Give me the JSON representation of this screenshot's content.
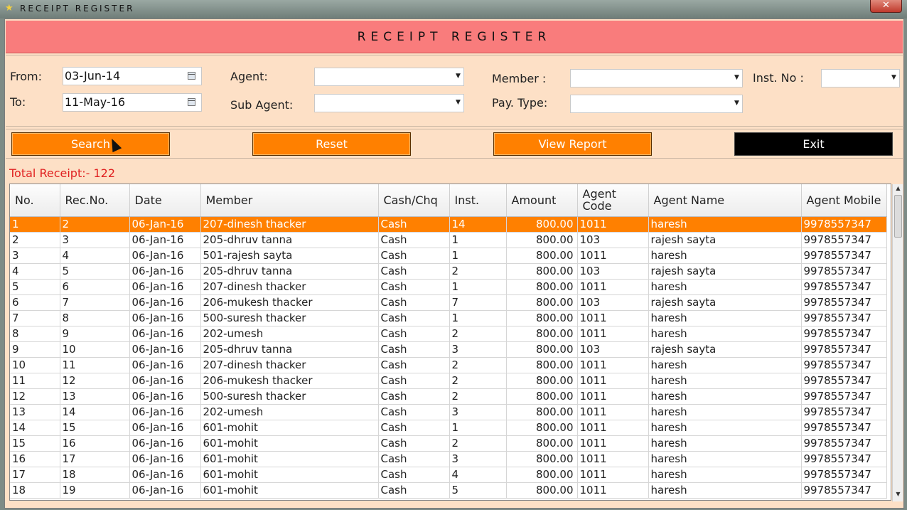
{
  "window": {
    "title": "RECEIPT REGISTER",
    "close_label": "✕"
  },
  "header": {
    "title": "RECEIPT REGISTER"
  },
  "filters": {
    "from_label": "From:",
    "from_value": "03-Jun-14",
    "to_label": "To:",
    "to_value": "11-May-16",
    "agent_label": "Agent:",
    "agent_value": "",
    "sub_agent_label": "Sub Agent:",
    "sub_agent_value": "",
    "member_label": "Member :",
    "member_value": "",
    "pay_type_label": "Pay. Type:",
    "pay_type_value": "",
    "inst_no_label": "Inst. No :",
    "inst_no_value": ""
  },
  "buttons": {
    "search": "Search",
    "reset": "Reset",
    "view_report": "View Report",
    "exit": "Exit"
  },
  "total_receipt": "Total Receipt:- 122",
  "table": {
    "headers": [
      "No.",
      "Rec.No.",
      "Date",
      "Member",
      "Cash/Chq",
      "Inst.",
      "Amount",
      "Agent Code",
      "Agent Name",
      "Agent Mobile"
    ],
    "selected_row": 0,
    "rows": [
      [
        "1",
        "2",
        "06-Jan-16",
        "207-dinesh thacker",
        "Cash",
        "14",
        "800.00",
        "1011",
        "haresh",
        "9978557347"
      ],
      [
        "2",
        "3",
        "06-Jan-16",
        "205-dhruv tanna",
        "Cash",
        "1",
        "800.00",
        "103",
        "rajesh sayta",
        "9978557347"
      ],
      [
        "3",
        "4",
        "06-Jan-16",
        "501-rajesh sayta",
        "Cash",
        "1",
        "800.00",
        "1011",
        "haresh",
        "9978557347"
      ],
      [
        "4",
        "5",
        "06-Jan-16",
        "205-dhruv tanna",
        "Cash",
        "2",
        "800.00",
        "103",
        "rajesh sayta",
        "9978557347"
      ],
      [
        "5",
        "6",
        "06-Jan-16",
        "207-dinesh thacker",
        "Cash",
        "1",
        "800.00",
        "1011",
        "haresh",
        "9978557347"
      ],
      [
        "6",
        "7",
        "06-Jan-16",
        "206-mukesh thacker",
        "Cash",
        "7",
        "800.00",
        "103",
        "rajesh sayta",
        "9978557347"
      ],
      [
        "7",
        "8",
        "06-Jan-16",
        "500-suresh thacker",
        "Cash",
        "1",
        "800.00",
        "1011",
        "haresh",
        "9978557347"
      ],
      [
        "8",
        "9",
        "06-Jan-16",
        "202-umesh",
        "Cash",
        "2",
        "800.00",
        "1011",
        "haresh",
        "9978557347"
      ],
      [
        "9",
        "10",
        "06-Jan-16",
        "205-dhruv tanna",
        "Cash",
        "3",
        "800.00",
        "103",
        "rajesh sayta",
        "9978557347"
      ],
      [
        "10",
        "11",
        "06-Jan-16",
        "207-dinesh thacker",
        "Cash",
        "2",
        "800.00",
        "1011",
        "haresh",
        "9978557347"
      ],
      [
        "11",
        "12",
        "06-Jan-16",
        "206-mukesh thacker",
        "Cash",
        "2",
        "800.00",
        "1011",
        "haresh",
        "9978557347"
      ],
      [
        "12",
        "13",
        "06-Jan-16",
        "500-suresh thacker",
        "Cash",
        "2",
        "800.00",
        "1011",
        "haresh",
        "9978557347"
      ],
      [
        "13",
        "14",
        "06-Jan-16",
        "202-umesh",
        "Cash",
        "3",
        "800.00",
        "1011",
        "haresh",
        "9978557347"
      ],
      [
        "14",
        "15",
        "06-Jan-16",
        "601-mohit",
        "Cash",
        "1",
        "800.00",
        "1011",
        "haresh",
        "9978557347"
      ],
      [
        "15",
        "16",
        "06-Jan-16",
        "601-mohit",
        "Cash",
        "2",
        "800.00",
        "1011",
        "haresh",
        "9978557347"
      ],
      [
        "16",
        "17",
        "06-Jan-16",
        "601-mohit",
        "Cash",
        "3",
        "800.00",
        "1011",
        "haresh",
        "9978557347"
      ],
      [
        "17",
        "18",
        "06-Jan-16",
        "601-mohit",
        "Cash",
        "4",
        "800.00",
        "1011",
        "haresh",
        "9978557347"
      ],
      [
        "18",
        "19",
        "06-Jan-16",
        "601-mohit",
        "Cash",
        "5",
        "800.00",
        "1011",
        "haresh",
        "9978557347"
      ]
    ]
  },
  "icons": {
    "app": "star-icon",
    "calendar": "calendar-icon",
    "dropdown": "chevron-down-icon",
    "cursor": "mouse-pointer-icon"
  },
  "colors": {
    "header_bg": "#f97c7c",
    "panel_bg": "#fde0c6",
    "button": "#ff8000",
    "exit_button": "#000000",
    "selected_row": "#ff8000",
    "total_text": "#e02020"
  }
}
